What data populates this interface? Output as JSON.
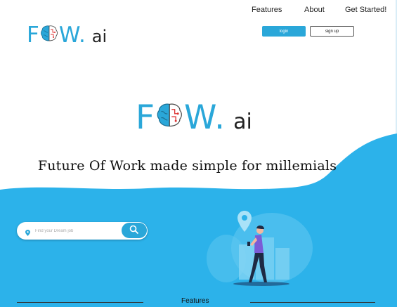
{
  "nav": {
    "features": "Features",
    "about": "About",
    "get_started": "Get Started!"
  },
  "auth": {
    "login": "login",
    "signup": "sign up"
  },
  "logo": {
    "main_left": "F",
    "main_right": "W.",
    "suffix": "ai"
  },
  "hero": {
    "tagline": "Future Of Work made simple for millemials"
  },
  "search": {
    "placeholder": "Find your Dream job"
  },
  "section": {
    "features_title": "Features"
  },
  "colors": {
    "brand": "#2aa7d9",
    "wave": "#2cb2ea",
    "text": "#111111"
  },
  "icons": [
    "location-pin-icon",
    "search-icon",
    "brain-icon"
  ]
}
